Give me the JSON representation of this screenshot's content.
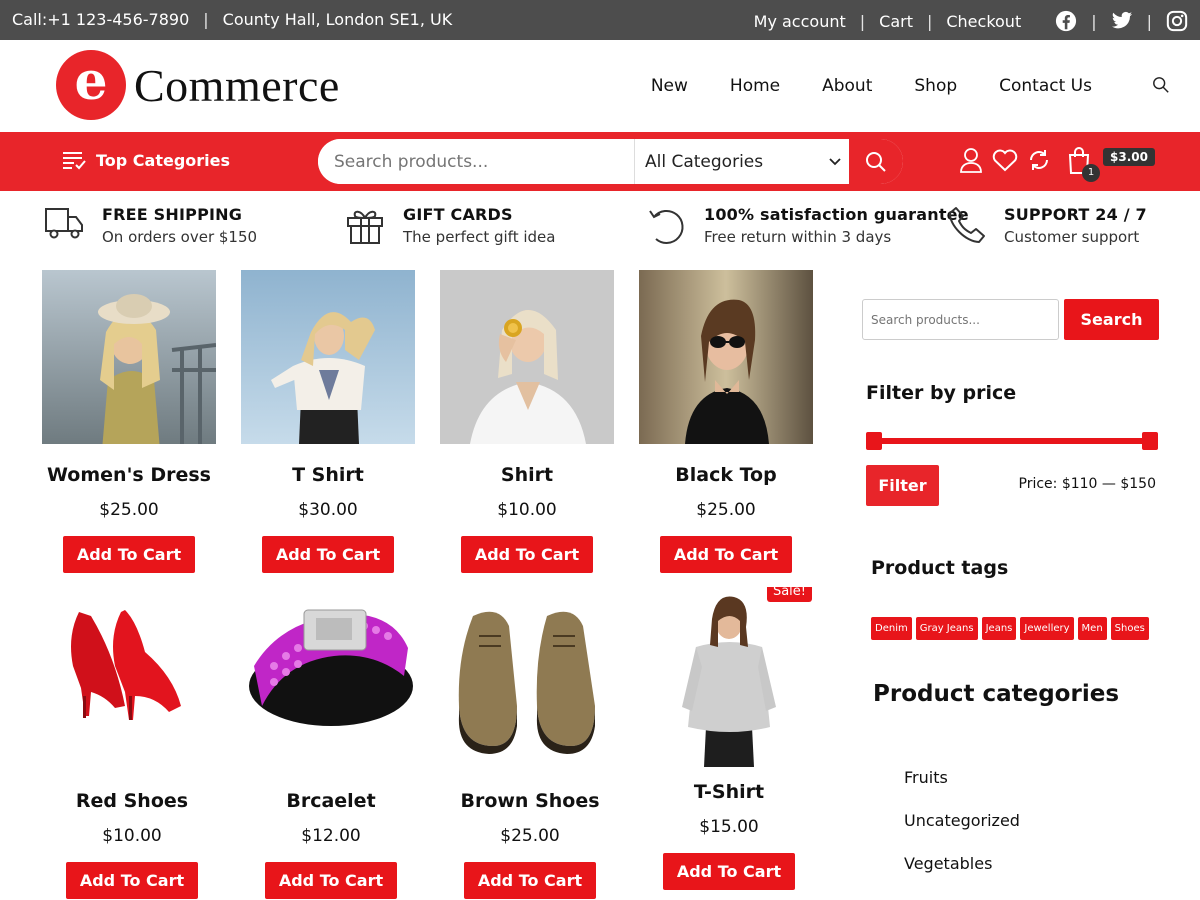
{
  "topbar": {
    "phone": "Call:+1 123-456-7890",
    "address": "County Hall, London SE1, UK",
    "links": [
      "My account",
      "Cart",
      "Checkout"
    ],
    "socials": [
      "facebook-icon",
      "twitter-icon",
      "instagram-icon"
    ]
  },
  "header": {
    "logo_letter": "e",
    "logo_text": "Commerce",
    "nav": [
      "New",
      "Home",
      "About",
      "Shop",
      "Contact Us"
    ]
  },
  "redbar": {
    "top_categories": "Top Categories",
    "search_placeholder": "Search products...",
    "category_selected": "All Categories",
    "cart_count": "1",
    "cart_total": "$3.00"
  },
  "features": [
    {
      "icon": "truck-icon",
      "title": "FREE SHIPPING",
      "sub": "On orders over $150"
    },
    {
      "icon": "gift-icon",
      "title": "GIFT CARDS",
      "sub": "The perfect gift idea"
    },
    {
      "icon": "refresh-icon",
      "title": "100% satisfaction guarantee",
      "sub": "Free return within 3 days"
    },
    {
      "icon": "phone-icon",
      "title": "SUPPORT 24 / 7",
      "sub": "Customer support"
    }
  ],
  "products": [
    {
      "name": "Women's Dress",
      "price": "$25.00",
      "button": "Add To Cart"
    },
    {
      "name": "T Shirt",
      "price": "$30.00",
      "button": "Add To Cart"
    },
    {
      "name": "Shirt",
      "price": "$10.00",
      "button": "Add To Cart"
    },
    {
      "name": "Black Top",
      "price": "$25.00",
      "button": "Add To Cart"
    },
    {
      "name": "Red Shoes",
      "price": "$10.00",
      "button": "Add To Cart"
    },
    {
      "name": "Brcaelet",
      "price": "$12.00",
      "button": "Add To Cart"
    },
    {
      "name": "Brown Shoes",
      "price": "$25.00",
      "button": "Add To Cart"
    },
    {
      "name": "T-Shirt",
      "price": "$15.00",
      "button": "Add To Cart",
      "badge": "Sale!"
    }
  ],
  "sidebar": {
    "search_placeholder": "Search products...",
    "search_button": "Search",
    "filter_title": "Filter by price",
    "filter_button": "Filter",
    "price_label": "Price: $110 — $150",
    "tags_title": "Product tags",
    "tags": [
      "Denim",
      "Gray Jeans",
      "Jeans",
      "Jewellery",
      "Men",
      "Shoes"
    ],
    "categories_title": "Product categories",
    "categories": [
      "Fruits",
      "Uncategorized",
      "Vegetables"
    ]
  },
  "colors": {
    "accent": "#e8252a",
    "topbar": "#4d4d4d"
  }
}
